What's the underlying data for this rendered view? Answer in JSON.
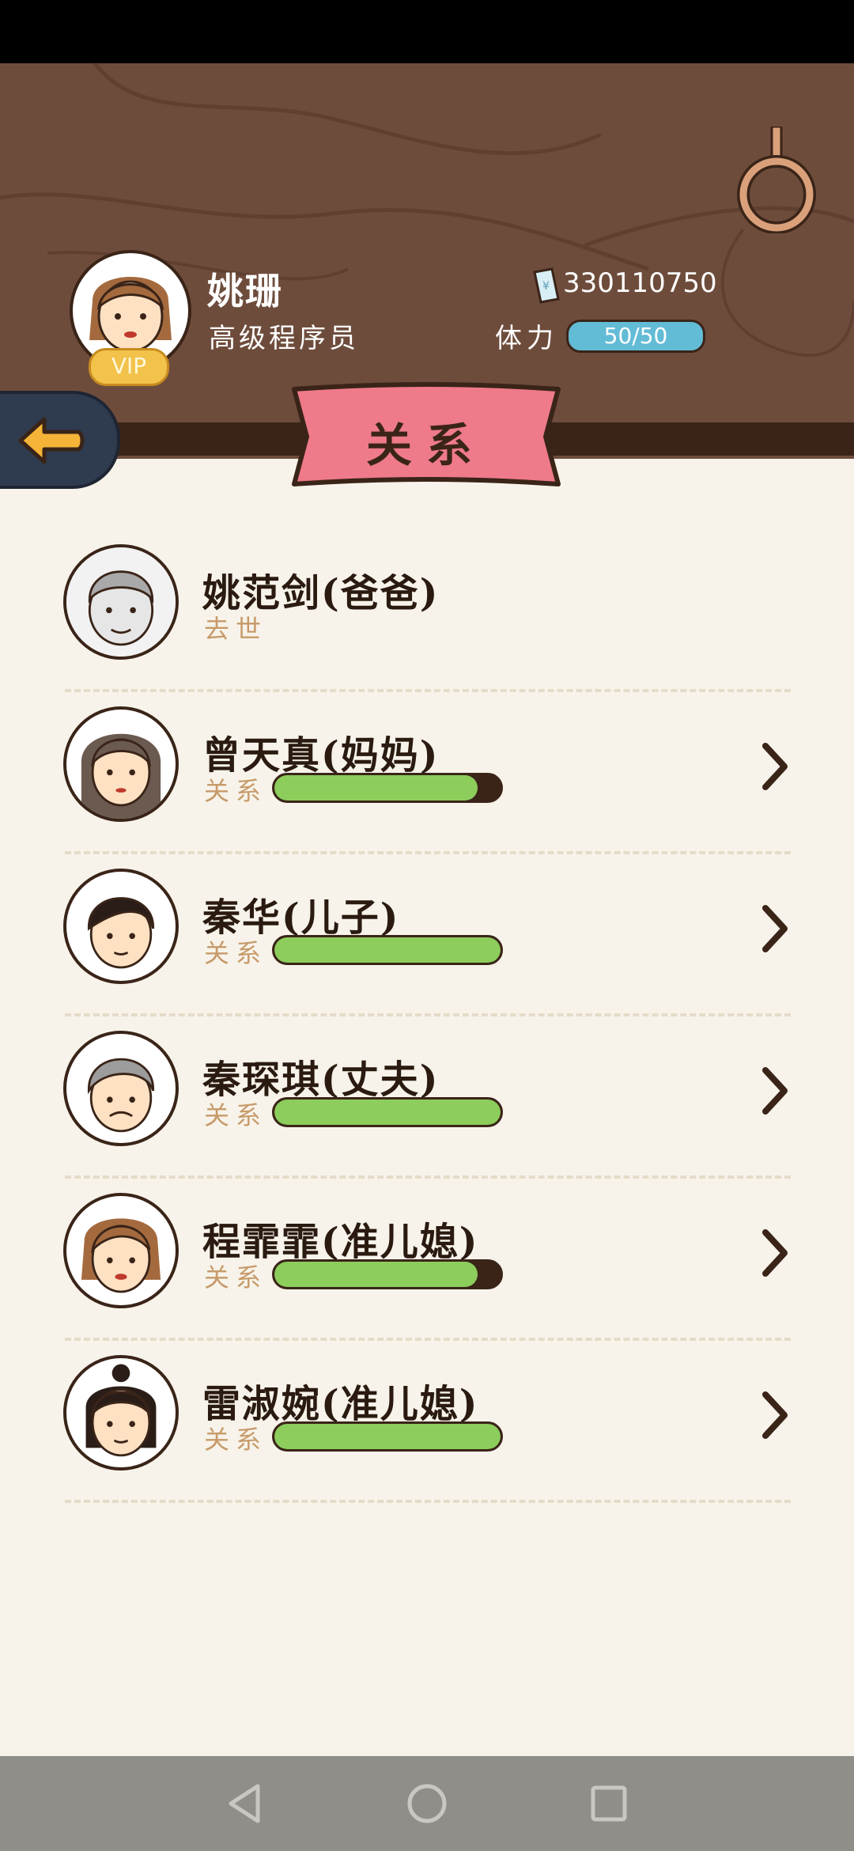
{
  "player": {
    "name": "姚珊",
    "title": "高级程序员",
    "vip_label": "VIP",
    "money": "330110750",
    "stamina_label": "体力",
    "stamina": "50/50"
  },
  "banner": {
    "title": "关系"
  },
  "relations": [
    {
      "name": "姚范剑(爸爸)",
      "status": "去世",
      "deceased": true
    },
    {
      "name": "曾天真(妈妈)",
      "status_label": "关系",
      "relationship": 0.9
    },
    {
      "name": "秦华(儿子)",
      "status_label": "关系",
      "relationship": 1.0
    },
    {
      "name": "秦琛琪(丈夫)",
      "status_label": "关系",
      "relationship": 1.0
    },
    {
      "name": "程霏霏(准儿媳)",
      "status_label": "关系",
      "relationship": 0.9
    },
    {
      "name": "雷淑婉(准儿媳)",
      "status_label": "关系",
      "relationship": 1.0
    }
  ],
  "colors": {
    "header": "#6e4c3c",
    "banner": "#ee7a8a",
    "bar_fill": "#8ccd5c",
    "stamina": "#63bcd6"
  }
}
